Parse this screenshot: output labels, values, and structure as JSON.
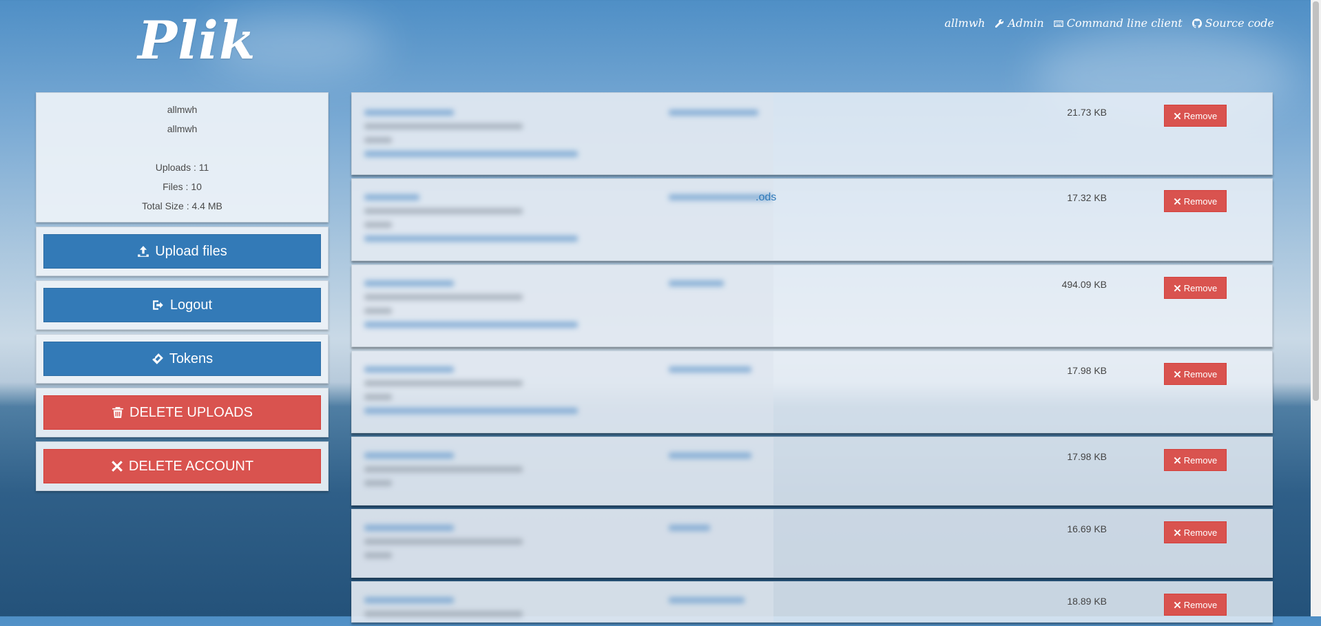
{
  "app": {
    "logo": "Plik"
  },
  "topnav": [
    {
      "label": "allmwh",
      "icon": ""
    },
    {
      "label": "Admin",
      "icon": "wrench-icon"
    },
    {
      "label": "Command line client",
      "icon": "keyboard-icon"
    },
    {
      "label": "Source code",
      "icon": "github-icon"
    }
  ],
  "user": {
    "login": "allmwh",
    "name": "allmwh",
    "uploads": "Uploads : 11",
    "files": "Files : 10",
    "total_size": "Total Size : 4.4 MB"
  },
  "actions": {
    "upload": "Upload files",
    "logout": "Logout",
    "tokens": "Tokens",
    "delete_uploads": "DELETE UPLOADS",
    "delete_account": "DELETE ACCOUNT"
  },
  "files": [
    {
      "size": "21.73 KB",
      "remove": "Remove",
      "ext": ""
    },
    {
      "size": "17.32 KB",
      "remove": "Remove",
      "ext": ".ods"
    },
    {
      "size": "494.09 KB",
      "remove": "Remove",
      "ext": ""
    },
    {
      "size": "17.98 KB",
      "remove": "Remove",
      "ext": ""
    },
    {
      "size": "17.98 KB",
      "remove": "Remove",
      "ext": ""
    },
    {
      "size": "16.69 KB",
      "remove": "Remove",
      "ext": ""
    },
    {
      "size": "18.89 KB",
      "remove": "Remove",
      "ext": ""
    }
  ],
  "colors": {
    "primary": "#337ab7",
    "danger": "#d9534f",
    "link": "#2f7ab9"
  }
}
